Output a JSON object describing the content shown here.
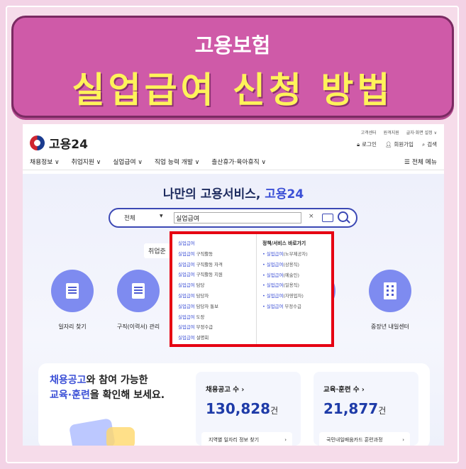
{
  "banner": {
    "subtitle": "고용보험",
    "title": "실업급여 신청 방법"
  },
  "site": {
    "logo_text": "고용24",
    "utility_links": [
      "고객센터",
      "원격지원",
      "글자·화면 설정 ∨"
    ],
    "login": "로그인",
    "signup": "회원가입",
    "search": "검색",
    "nav": [
      "채용정보 ∨",
      "취업지원 ∨",
      "실업급여 ∨",
      "직업 능력 개발 ∨",
      "출산휴가·육아휴직 ∨"
    ],
    "all_menu": "☰ 전체 메뉴"
  },
  "hero": {
    "title_prefix": "나만의 고용서비스, ",
    "title_brand": "고용24",
    "search_category": "전체",
    "search_value": "실업급여",
    "clear": "×",
    "tag_left": "취업준"
  },
  "services": [
    {
      "label": "일자리 찾기"
    },
    {
      "label": "구직(이력서) 관리"
    },
    {
      "label": "중장년 내일센터"
    }
  ],
  "dropdown": {
    "suggestions": [
      {
        "hl": "실업급여",
        "rest": ""
      },
      {
        "hl": "실업급여",
        "rest": " 구직활동"
      },
      {
        "hl": "실업급여",
        "rest": " 구직활동 자격"
      },
      {
        "hl": "실업급여",
        "rest": " 구직활동 지원"
      },
      {
        "hl": "실업급여",
        "rest": " 담당"
      },
      {
        "hl": "실업급여",
        "rest": " 담당자"
      },
      {
        "hl": "실업급여",
        "rest": " 담당자 통보"
      },
      {
        "hl": "실업급여",
        "rest": " 도장"
      },
      {
        "hl": "실업급여",
        "rest": " 부정수급"
      },
      {
        "hl": "실업급여",
        "rest": " 설명회"
      }
    ],
    "shortcut_title": "정책/서비스 바로가기",
    "shortcuts": [
      {
        "hl": "• 실업급여",
        "rest": "(노무제공자)"
      },
      {
        "hl": "• 실업급여",
        "rest": "(상용직)"
      },
      {
        "hl": "• 실업급여",
        "rest": "(예술인)"
      },
      {
        "hl": "• 실업급여",
        "rest": "(일용직)"
      },
      {
        "hl": "• 실업급여",
        "rest": "(자영업자)"
      },
      {
        "hl": "• 실업급여",
        "rest": " 부정수급"
      }
    ]
  },
  "promo": {
    "line1_blue": "채용공고",
    "line1_rest": "와 참여 가능한",
    "line2_blue": "교육·훈련",
    "line2_rest": "을 확인해 보세요."
  },
  "stats": [
    {
      "label": "채용공고 수 ›",
      "value": "130,828",
      "unit": "건",
      "button": "지역별 일자리 정보 찾기",
      "chevron": "›"
    },
    {
      "label": "교육·훈련 수 ›",
      "value": "21,877",
      "unit": "건",
      "button": "국민내일배움카드 훈련과정",
      "chevron": "›"
    }
  ]
}
